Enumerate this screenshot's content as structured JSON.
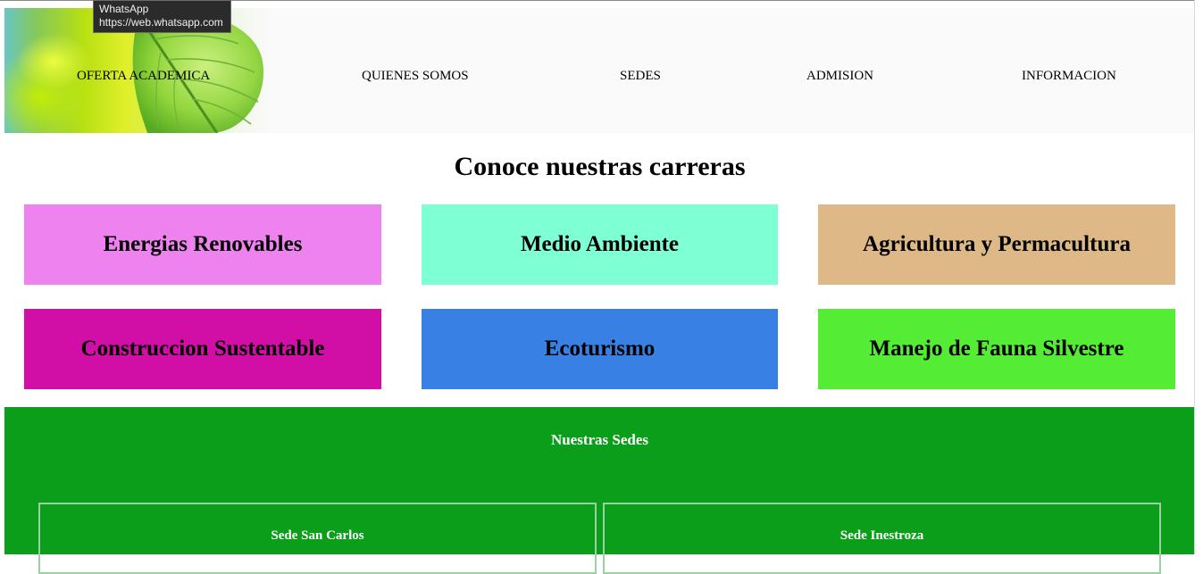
{
  "tooltip": {
    "title": "WhatsApp",
    "url": "https://web.whatsapp.com"
  },
  "header": {
    "banner_icon": "leaf-image",
    "nav": [
      {
        "label": "OFERTA ACADEMICA"
      },
      {
        "label": "QUIENES SOMOS"
      },
      {
        "label": "SEDES"
      },
      {
        "label": "ADMISION"
      },
      {
        "label": "INFORMACION"
      }
    ]
  },
  "main": {
    "title": "Conoce nuestras carreras",
    "careers": [
      {
        "label": "Energias Renovables",
        "color": "#ee82ee"
      },
      {
        "label": "Medio Ambiente",
        "color": "#7fffd4"
      },
      {
        "label": "Agricultura y Permacultura",
        "color": "#deb887"
      },
      {
        "label": "Construccion Sustentable",
        "color": "#d10fa6"
      },
      {
        "label": "Ecoturismo",
        "color": "#3880e4"
      },
      {
        "label": "Manejo de Fauna Silvestre",
        "color": "#54ec34"
      }
    ]
  },
  "sedes": {
    "title": "Nuestras Sedes",
    "color": "#0a9e1a",
    "items": [
      {
        "label": "Sede San Carlos"
      },
      {
        "label": "Sede Inestroza"
      }
    ]
  }
}
